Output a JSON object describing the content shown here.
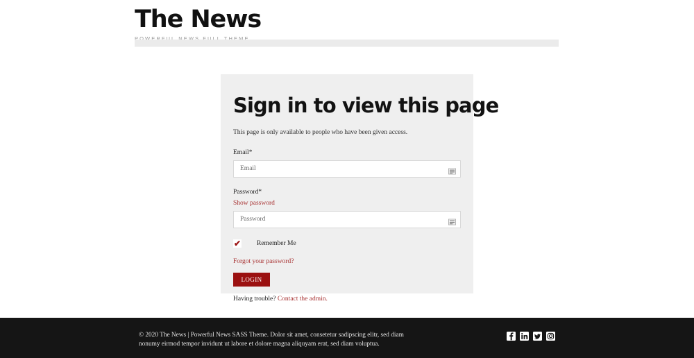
{
  "header": {
    "brand_title": "The News",
    "brand_tagline": "POWERFUL NEWS FULL THEME",
    "nav_items": []
  },
  "signin": {
    "title": "Sign in to view this page",
    "subtitle": "This page is only available to people who have been given access.",
    "email": {
      "label": "Email*",
      "placeholder": "Email",
      "value": "",
      "affix_icon": "autofill-icon"
    },
    "password": {
      "label": "Password*",
      "show_password_link": "Show password",
      "placeholder": "Password",
      "value": "",
      "affix_icon": "autofill-icon"
    },
    "remember": {
      "label": "Remember Me",
      "checked": true,
      "check_glyph": "✔"
    },
    "forgot_link": "Forgot your password?",
    "login_button": "LOGIN",
    "trouble_prefix": "Having trouble? ",
    "trouble_link": "Contact the admin."
  },
  "footer": {
    "text": "© 2020 The News | Powerful News SASS Theme. Dolor sit amet, consetetur sadipscing elitr, sed diam nonumy eirmod tempor invidunt ut labore et dolore magna aliquyam erat, sed diam voluptua.",
    "social": [
      {
        "name": "facebook-icon",
        "label": "Facebook"
      },
      {
        "name": "linkedin-icon",
        "label": "LinkedIn"
      },
      {
        "name": "twitter-icon",
        "label": "Twitter"
      },
      {
        "name": "instagram-icon",
        "label": "Instagram"
      }
    ]
  },
  "colors": {
    "accent_red": "#9b1111",
    "link_red": "#a83232",
    "card_bg": "#efefef",
    "footer_bg": "#151515",
    "nav_bg": "#ebebeb"
  }
}
